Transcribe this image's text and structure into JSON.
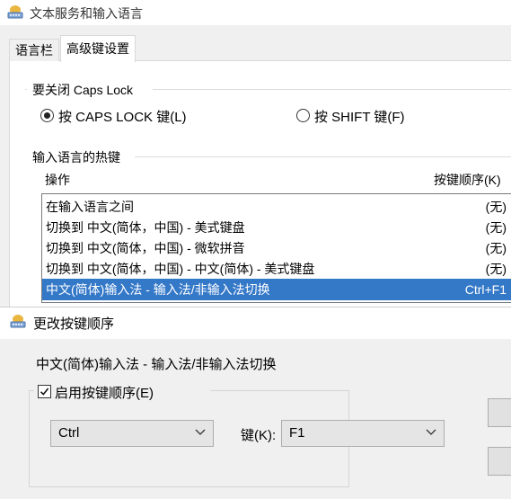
{
  "window": {
    "title": "文本服务和输入语言",
    "icon": "keyboard-globe-icon"
  },
  "tabs": [
    {
      "label": "语言栏",
      "active": false
    },
    {
      "label": "高级键设置",
      "active": true
    }
  ],
  "caps_lock": {
    "group_label": "要关闭 Caps Lock",
    "options": [
      {
        "label": "按 CAPS LOCK 键(L)",
        "selected": true
      },
      {
        "label": "按 SHIFT 键(F)",
        "selected": false
      }
    ]
  },
  "hotkeys": {
    "group_label": "输入语言的热键",
    "col_action": "操作",
    "col_keys": "按键顺序(K)",
    "rows": [
      {
        "name": "在输入语言之间",
        "key": "(无)"
      },
      {
        "name": "切换到 中文(简体，中国) - 美式键盘",
        "key": "(无)"
      },
      {
        "name": "切换到 中文(简体，中国) - 微软拼音",
        "key": "(无)"
      },
      {
        "name": "切换到 中文(简体，中国) - 中文(简体) - 美式键盘",
        "key": "(无)"
      },
      {
        "name": "中文(简体)输入法 - 输入法/非输入法切换",
        "key": "Ctrl+F1",
        "selected": true
      }
    ]
  },
  "dialog": {
    "title": "更改按键顺序",
    "icon": "keyboard-globe-icon",
    "description": "中文(简体)输入法 - 输入法/非输入法切换",
    "enable_label": "启用按键顺序(E)",
    "enable_checked": true,
    "modifier_value": "Ctrl",
    "key_label": "键(K):",
    "key_value": "F1"
  },
  "colors": {
    "selection": "#3478c8",
    "panel": "#ffffff",
    "background": "#f0f0f0"
  }
}
